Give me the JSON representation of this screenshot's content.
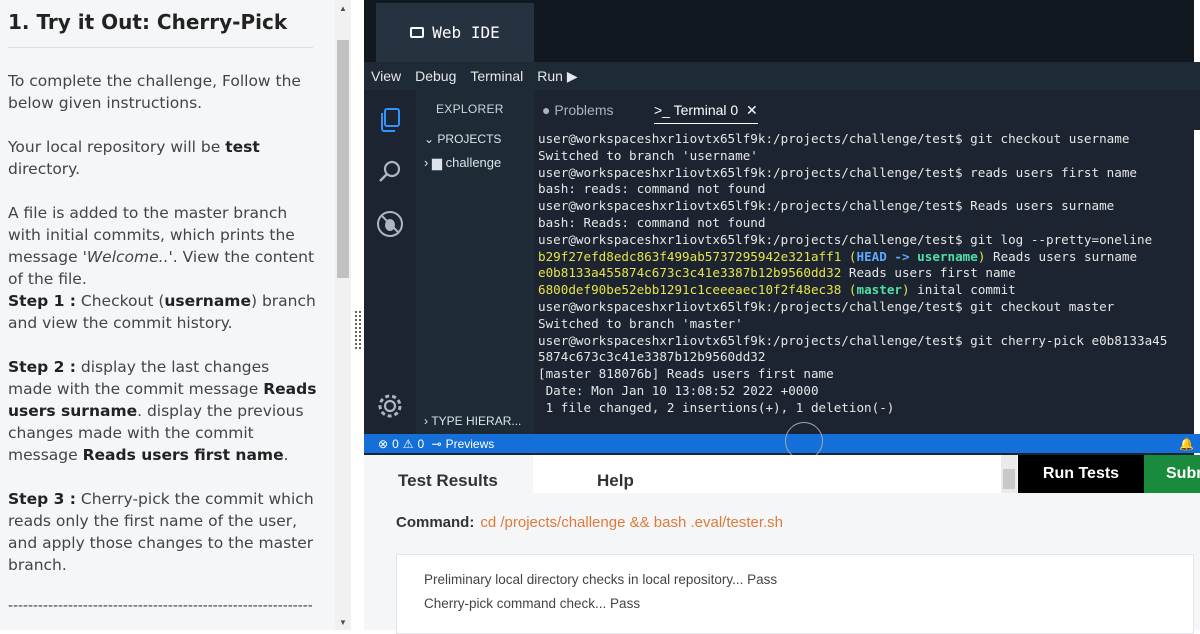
{
  "instructions": {
    "title": "1. Try it Out: Cherry-Pick",
    "p1": "To complete the challenge, Follow the below given instructions.",
    "p2_pre": "Your local repository will be ",
    "p2_bold": "test",
    "p2_post": " directory.",
    "p3_pre": "A file is added to the master branch with initial commits, which prints the message '",
    "p3_em": "Welcome..",
    "p3_post": "'. View the content of the file.",
    "s1_label": "Step 1 :",
    "s1_pre": " Checkout (",
    "s1_bold": "username",
    "s1_post": ") branch and view the commit history.",
    "s2_label": "Step 2 :",
    "s2_pre": " display the last changes made with the commit message ",
    "s2_bold1": "Reads users surname",
    "s2_mid": ". display the previous changes made with the commit message ",
    "s2_bold2": "Reads users first name",
    "s2_post": ".",
    "s3_label": "Step 3 :",
    "s3_text": " Cherry-pick the commit which reads only the first name of the user, and apply those changes to the master branch.",
    "divider": "----------------------------------------------------------------"
  },
  "ide": {
    "brand": "Web IDE",
    "menu": [
      "View",
      "Debug",
      "Terminal",
      "Run ▶"
    ],
    "explorer_header": "EXPLORER",
    "projects_label": "PROJECTS",
    "folder": "challenge",
    "type_hierarchy": "TYPE HIERAR...",
    "tab_problems": "Problems",
    "tab_terminal": "Terminal 0",
    "terminal_lines": [
      "user@workspaceshxr1iovtx65lf9k:/projects/challenge/test$ git checkout username",
      "Switched to branch 'username'",
      "user@workspaceshxr1iovtx65lf9k:/projects/challenge/test$ reads users first name",
      "bash: reads: command not found",
      "user@workspaceshxr1iovtx65lf9k:/projects/challenge/test$ Reads users surname",
      "bash: Reads: command not found",
      "user@workspaceshxr1iovtx65lf9k:/projects/challenge/test$ git log --pretty=oneline"
    ],
    "log1_hash": "b29f27efd8edc863f499ab5737295942e321aff1",
    "log1_head": "HEAD ->",
    "log1_branch": "username",
    "log1_msg": " Reads users surname",
    "log2_hash": "e0b8133a455874c673c3c41e3387b12b9560dd32",
    "log2_msg": " Reads users first name",
    "log3_hash": "6800def90be52ebb1291c1ceeeaec10f2f48ec38",
    "log3_branch": "master",
    "log3_msg": " inital commit",
    "terminal_lines2": [
      "user@workspaceshxr1iovtx65lf9k:/projects/challenge/test$ git checkout master",
      "Switched to branch 'master'",
      "user@workspaceshxr1iovtx65lf9k:/projects/challenge/test$ git cherry-pick e0b8133a45",
      "5874c673c3c41e3387b12b9560dd32",
      "[master 818076b] Reads users first name",
      " Date: Mon Jan 10 13:08:52 2022 +0000",
      " 1 file changed, 2 insertions(+), 1 deletion(-)"
    ],
    "status_errors": "0",
    "status_warnings": "0",
    "status_previews": "Previews"
  },
  "bottom": {
    "tab_results": "Test Results",
    "tab_help": "Help",
    "run_label": "Run Tests",
    "submit_label": "Submit",
    "command_label": "Command:",
    "command_value": "cd /projects/challenge && bash .eval/tester.sh",
    "result1": "Preliminary local directory checks in local repository... Pass",
    "result2": "Cherry-pick command check... Pass"
  }
}
